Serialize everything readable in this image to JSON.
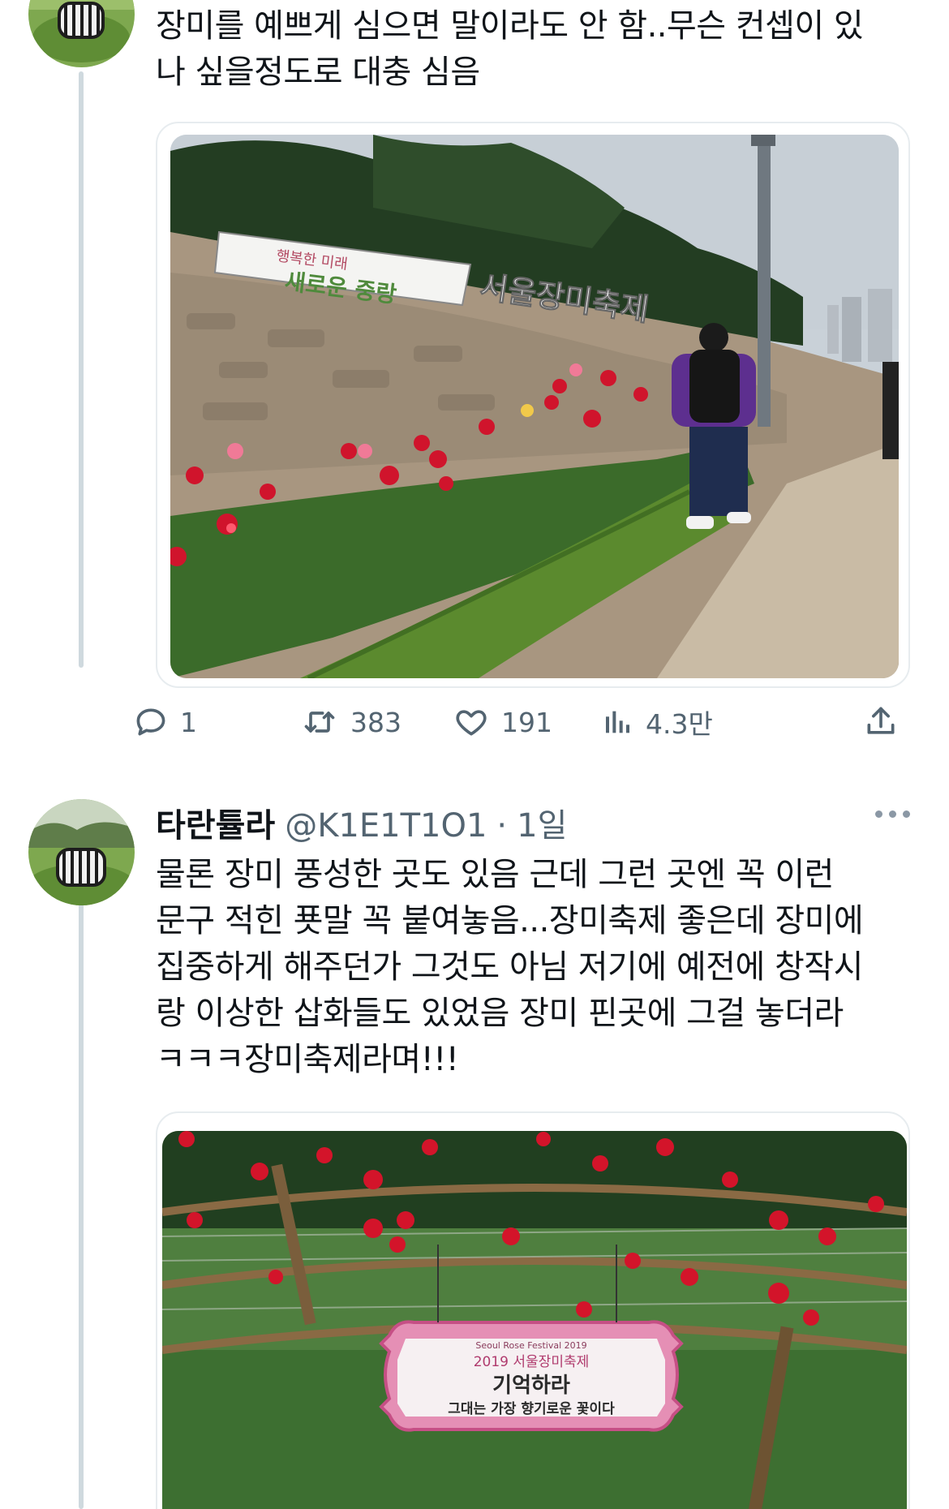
{
  "tweet1": {
    "text": "장미를 예쁘게 심으면 말이라도 안 함..무슨 컨셉이 있\n나 싶을정도로 대충 심음",
    "actions": {
      "reply_count": "1",
      "retweet_count": "383",
      "like_count": "191",
      "view_count": "4.3만"
    }
  },
  "tweet2": {
    "author_name": "타란튤라",
    "author_handle": "@K1E1T1O1",
    "separator": "·",
    "time": "1일",
    "text": "물론 장미 풍성한 곳도 있음 근데 그런 곳엔 꼭 이런\n문구 적힌 푯말 꼭 붙여놓음...장미축제 좋은데 장미에\n집중하게 해주던가 그것도 아님 저기에 예전에 창작시\n랑 이상한 삽화들도 있었음 장미 핀곳에 그걸 놓더라\nㅋㅋㅋ장미축제라며!!!"
  },
  "photo1": {
    "banner_small": "행복한 미래",
    "banner_main": "새로운 중랑",
    "sign_letters": "서울장미축제"
  },
  "photo2": {
    "sign_top": "Seoul Rose Festival 2019",
    "sign_sub": "2019 서울장미축제",
    "sign_title": "기억하라",
    "sign_body": "그대는 가장 향기로운 꽃이다"
  },
  "icons": [
    "reply-icon",
    "retweet-icon",
    "like-icon",
    "views-icon",
    "share-icon",
    "more-icon"
  ],
  "colors": {
    "icon_gray": "#536471",
    "thread_line": "#cfd9de",
    "text": "#0f1419"
  }
}
